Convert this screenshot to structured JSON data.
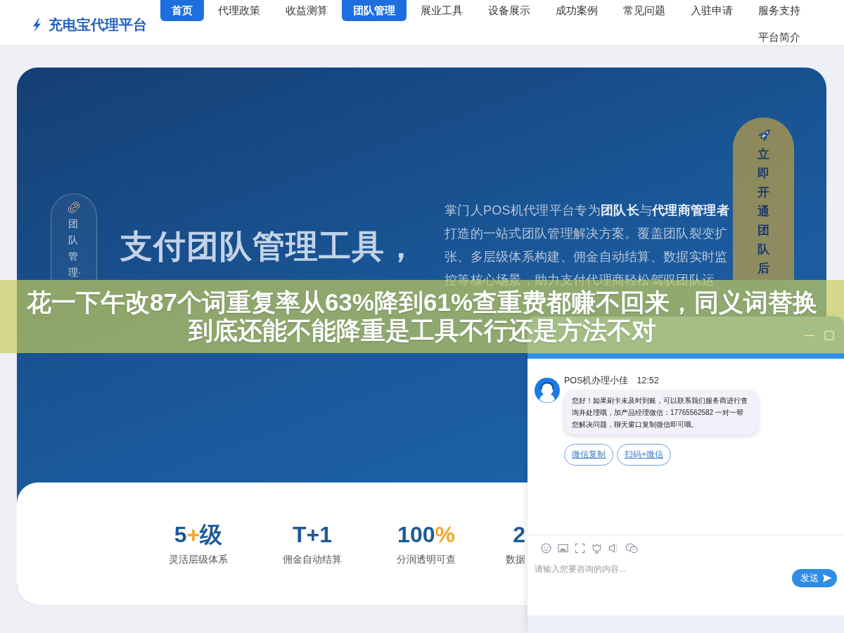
{
  "header": {
    "logo": "充电宝代理平台",
    "nav": [
      {
        "label": "首页",
        "selected": true
      },
      {
        "label": "代理政策",
        "selected": false
      },
      {
        "label": "收益测算",
        "selected": false
      },
      {
        "label": "团队管理",
        "selected": true
      },
      {
        "label": "展业工具",
        "selected": false
      },
      {
        "label": "设备展示",
        "selected": false
      },
      {
        "label": "成功案例",
        "selected": false
      },
      {
        "label": "常见问题",
        "selected": false
      },
      {
        "label": "入驻申请",
        "selected": false
      },
      {
        "label": "服务支持",
        "selected": false
      },
      {
        "label": "平台简介",
        "selected": false
      }
    ]
  },
  "hero": {
    "side_tag": "团队管理·",
    "headline": "支付团队管理工具，",
    "description": "掌门人POS机代理平台专为**团队长**与**代理商管理者**打造的一站式团队管理解决方案。覆盖团队裂变扩张、多层级体系构建、佣金自动结算、数据实时监控等核心场景，助力支付代理商轻松驾驭团队运",
    "cta": "立即开通团队后"
  },
  "stats": [
    {
      "number": "5",
      "accent": "+",
      "unit": "级",
      "label": "灵活层级体系"
    },
    {
      "number": "T+1",
      "label": "佣金自动结算"
    },
    {
      "number": "100",
      "accent": "%",
      "label": "分润透明可查"
    },
    {
      "number": "2",
      "label": "数据"
    }
  ],
  "chat": {
    "agent": "POS机办理小佳",
    "time": "12:52",
    "message": "您好！如果刷卡未及时到账，可以联系我们服务商进行查询并处理哦，加产品经理微信：17765562582 一对一帮您解决问题，聊天窗口复制微信即可哦。",
    "quick_replies": [
      "微信复制",
      "扫码+微信"
    ],
    "input": {
      "placeholder": "请输入您要咨询的内容..."
    },
    "send": "发送"
  },
  "caption_banner": {
    "lines": [
      "花一下午改87个词重复率从63%降到61%查重费都赚不回来，同义词替换",
      "到底还能不能降重是工具不行还是方法不对"
    ]
  }
}
